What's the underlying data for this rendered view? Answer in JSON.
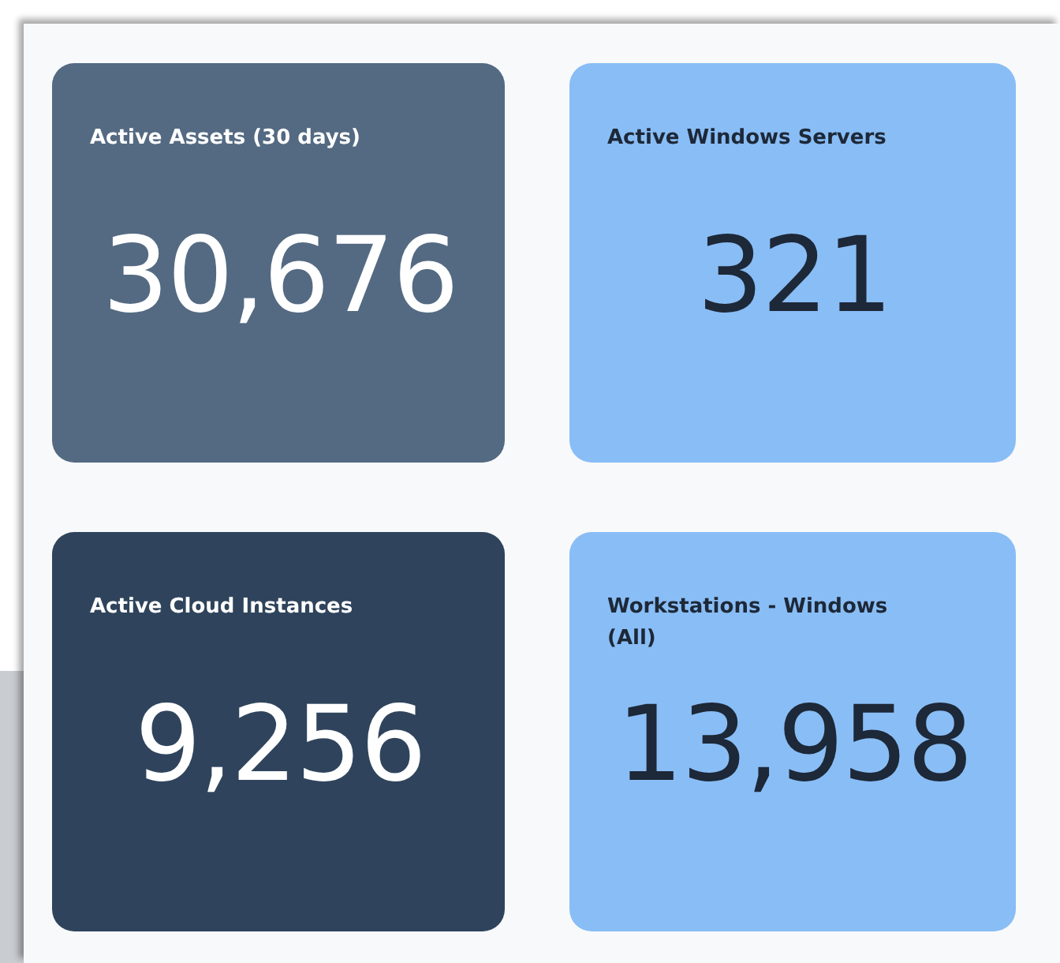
{
  "tiles": [
    {
      "title": "Active Assets (30 days)",
      "value": "30,676",
      "color": "#546a82"
    },
    {
      "title": "Active Windows Servers",
      "value": "321",
      "color": "#89bdf5"
    },
    {
      "title": "Active Cloud Instances",
      "value": "9,256",
      "color": "#2f445c"
    },
    {
      "title": "Workstations - Windows (All)",
      "value": "13,958",
      "color": "#89bdf5"
    }
  ]
}
